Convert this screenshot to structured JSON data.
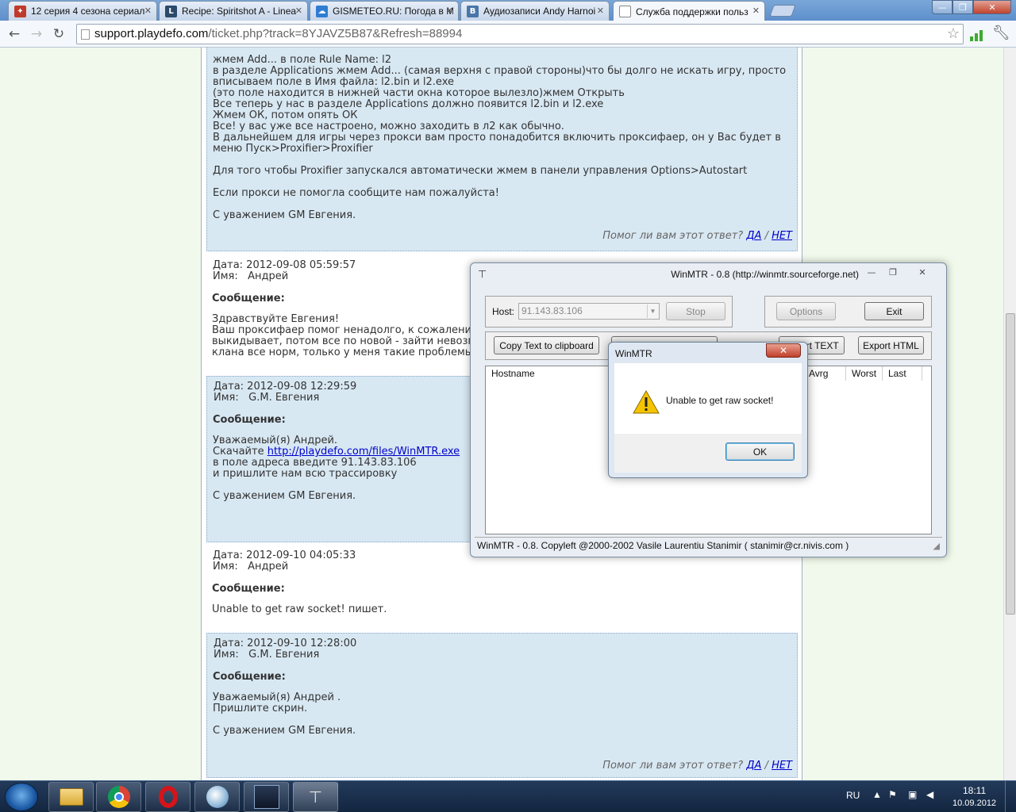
{
  "browser": {
    "tabs": [
      {
        "title": "12 серия 4 сезона сериал",
        "icon_color": "#c03a2b",
        "icon": "puzzle-icon"
      },
      {
        "title": "Recipe: Spiritshot A - Linea",
        "icon_color": "#2b4a6a",
        "icon": "lineage-icon"
      },
      {
        "title": "GISMETEO.RU: Погода в М",
        "icon_color": "#2f7dd3",
        "icon": "weather-icon"
      },
      {
        "title": "Аудиозаписи Andy Harnoi",
        "icon_color": "#4a76a8",
        "icon": "vk-icon"
      },
      {
        "title": "Служба поддержки польз",
        "icon_color": "#ffffff",
        "icon": "page-icon"
      }
    ],
    "url_host": "support.playdefo.com",
    "url_path": "/ticket.php?track=8YJAVZ5B87&Refresh=88994"
  },
  "ticket": {
    "first_block_lines": "жмем Add... в поле Rule Name: l2\nв разделе Applications жмем Add... (самая верхня с правой стороны)что бы долго не искать игру, просто вписываем поле в Имя файла: l2.bin и l2.exe\n(это поле находится в нижней части окна которое вылезло)жмем Открыть\nВсе теперь у нас в разделе Applications должно появится l2.bin и l2.exe\nЖмем ОК, потом опять ОК\nВсе! у вас уже все настроено, можно заходить в л2 как обычно.\nВ дальнейшем для игры через прокси вам просто понадобится включить проксифаер, он у Вас будет в меню Пуск>Proxifier>Proxifier\n\nДля того чтобы Proxifier запускался автоматически жмем в панели управления Options>Autostart\n\nЕсли прокси не помогла сообщите нам пожалуйста!\n\nС уважением GM Евгения.",
    "helpful_prompt": "Помог ли вам этот ответ?",
    "yes": "ДА",
    "sep": "/",
    "no": "НЕТ",
    "messages": [
      {
        "date": "Дата: 2012-09-08 05:59:57",
        "name_label": "Имя:",
        "name": "Андрей",
        "heading": "Сообщение:",
        "body": "Здравствуйте Евгения!\nВаш проксифаер помог ненадолго, к сожалению.\nвыкидывает, потом все по новой - зайти невозмож\nклана все норм, только у меня такие проблемы."
      },
      {
        "date": "Дата: 2012-09-08 12:29:59",
        "name_label": "Имя:",
        "name": "G.M. Евгения",
        "heading": "Сообщение:",
        "body_pre": "Уважаемый(я) Андрей.\nСкачайте ",
        "link": "http://playdefo.com/files/WinMTR.exe",
        "body_post": "\nв поле адреса введите 91.143.83.106\nи пришлите нам всю трассировку\n\nС уважением GM Евгения."
      },
      {
        "date": "Дата: 2012-09-10 04:05:33",
        "name_label": "Имя:",
        "name": "Андрей",
        "heading": "Сообщение:",
        "body": "Unable to get raw socket! пишет."
      },
      {
        "date": "Дата: 2012-09-10 12:28:00",
        "name_label": "Имя:",
        "name": "G.M. Евгения",
        "heading": "Сообщение:",
        "body": "Уважаемый(я) Андрей .\nПришлите скрин.\n\nС уважением GM Евгения."
      }
    ]
  },
  "winmtr": {
    "title": "WinMTR - 0.8 (http://winmtr.sourceforge.net)",
    "host_label": "Host:",
    "host_value": "91.143.83.106",
    "stop": "Stop",
    "options": "Options",
    "exit": "Exit",
    "copy_text": "Copy Text to clipboard",
    "export_text": "Export TEXT",
    "export_html": "Export HTML",
    "columns": [
      "Hostname",
      "Avrg",
      "Worst",
      "Last"
    ],
    "status": "WinMTR - 0.8. Copyleft @2000-2002 Vasile Laurentiu Stanimir  ( stanimir@cr.nivis.com )"
  },
  "dialog": {
    "title": "WinMTR",
    "message": "Unable to get raw socket!",
    "ok": "OK"
  },
  "taskbar": {
    "lang": "RU",
    "time": "18:11",
    "date": "10.09.2012",
    "apps": [
      "explorer-icon",
      "chrome-icon",
      "opera-icon",
      "skype-icon",
      "lineage-icon",
      "winmtr-icon"
    ]
  }
}
